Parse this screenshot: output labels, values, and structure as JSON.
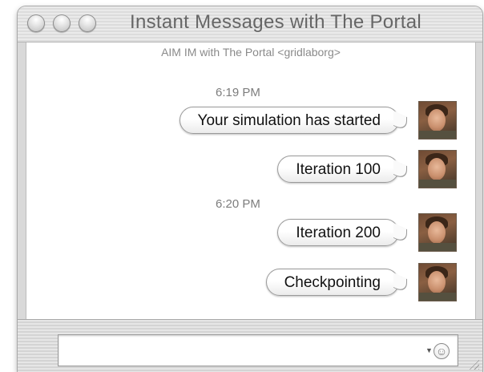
{
  "window": {
    "title": "Instant Messages with The Portal"
  },
  "chat": {
    "header": "AIM IM with The Portal <gridlaborg>",
    "groups": [
      {
        "time": "6:19 PM",
        "messages": [
          "Your simulation has started",
          "Iteration 100"
        ]
      },
      {
        "time": "6:20 PM",
        "messages": [
          "Iteration 200",
          "Checkpointing"
        ]
      }
    ]
  },
  "input": {
    "value": "",
    "emoji_icon": "smiley-icon"
  }
}
